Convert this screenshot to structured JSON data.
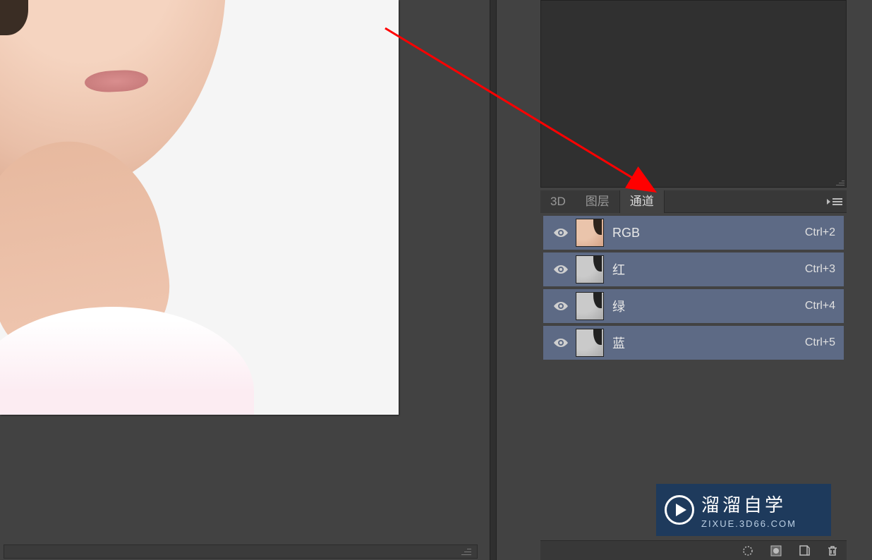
{
  "tabs": {
    "t3d": "3D",
    "layers": "图层",
    "channels": "通道"
  },
  "channels": [
    {
      "name": "RGB",
      "shortcut": "Ctrl+2",
      "gray": false
    },
    {
      "name": "红",
      "shortcut": "Ctrl+3",
      "gray": true
    },
    {
      "name": "绿",
      "shortcut": "Ctrl+4",
      "gray": true
    },
    {
      "name": "蓝",
      "shortcut": "Ctrl+5",
      "gray": true
    }
  ],
  "watermark": {
    "title": "溜溜自学",
    "sub": "ZIXUE.3D66.COM"
  }
}
